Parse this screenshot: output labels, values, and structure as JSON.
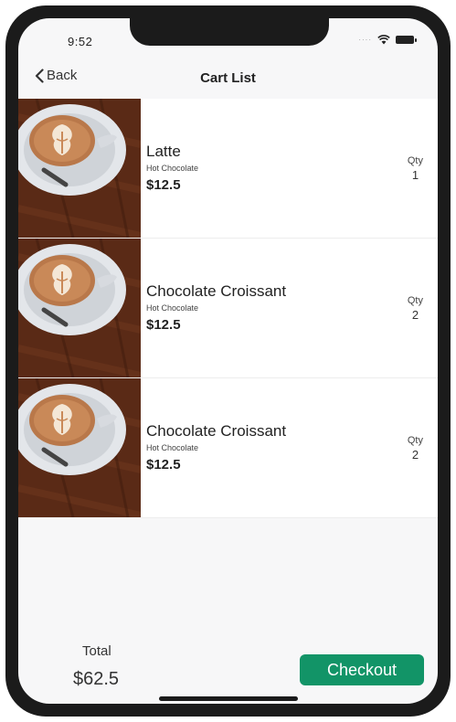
{
  "status_bar": {
    "time": "9:52",
    "signal": "····"
  },
  "nav": {
    "back_label": "Back",
    "title": "Cart List"
  },
  "cart": {
    "qty_label": "Qty",
    "items": [
      {
        "name": "Latte",
        "subtitle": "Hot Chocolate",
        "price": "$12.5",
        "qty": "1"
      },
      {
        "name": "Chocolate Croissant",
        "subtitle": "Hot Chocolate",
        "price": "$12.5",
        "qty": "2"
      },
      {
        "name": "Chocolate Croissant",
        "subtitle": "Hot Chocolate",
        "price": "$12.5",
        "qty": "2"
      }
    ]
  },
  "footer": {
    "total_label": "Total",
    "total_value": "$62.5",
    "checkout_label": "Checkout"
  },
  "colors": {
    "accent": "#129467",
    "frame": "#1b1b1b",
    "screen_bg": "#f7f7f8"
  },
  "icons": {
    "back": "chevron-left-icon",
    "wifi": "wifi-icon",
    "battery": "battery-icon",
    "thumbnail": "latte-cup-image"
  }
}
